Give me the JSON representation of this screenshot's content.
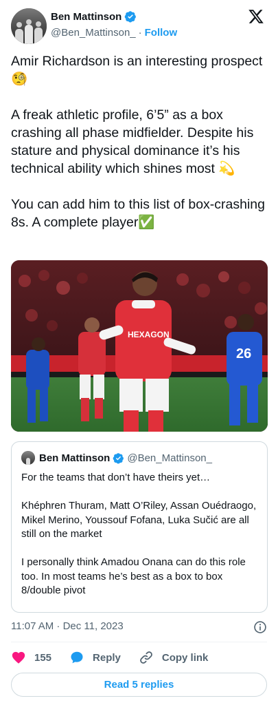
{
  "author": {
    "display_name": "Ben Mattinson",
    "handle": "@Ben_Mattinson_",
    "separator": "·",
    "follow_label": "Follow"
  },
  "tweet": {
    "text": "Amir Richardson is an interesting prospect🧐\n\nA freak athletic profile, 6’5” as a box crashing all phase midfielder. Despite his stature and physical dominance it’s his technical ability which shines most 💫\n\nYou can add him to this list of box-crashing 8s. A complete player✅"
  },
  "media": {
    "shirt_text": "HEXAGON",
    "opponent_number": "26"
  },
  "quote": {
    "display_name": "Ben Mattinson",
    "handle": "@Ben_Mattinson_",
    "text": "For the teams that don’t have theirs yet…\n\nKhéphren Thuram, Matt O’Riley, Assan Ouédraogo, Mikel Merino, Youssouf Fofana, Luka Sučić are all still on the market\n\nI personally think Amadou Onana can do this role too. In most teams he’s best as a box to box 8/double pivot"
  },
  "meta": {
    "timestamp": "11:07 AM · Dec 11, 2023"
  },
  "actions": {
    "like_count": "155",
    "reply_label": "Reply",
    "copy_label": "Copy link"
  },
  "replies_button": "Read 5 replies",
  "colors": {
    "accent": "#1d9bf0",
    "like": "#f91880",
    "text": "#0f1419",
    "muted": "#536471",
    "border": "#cfd9de"
  }
}
